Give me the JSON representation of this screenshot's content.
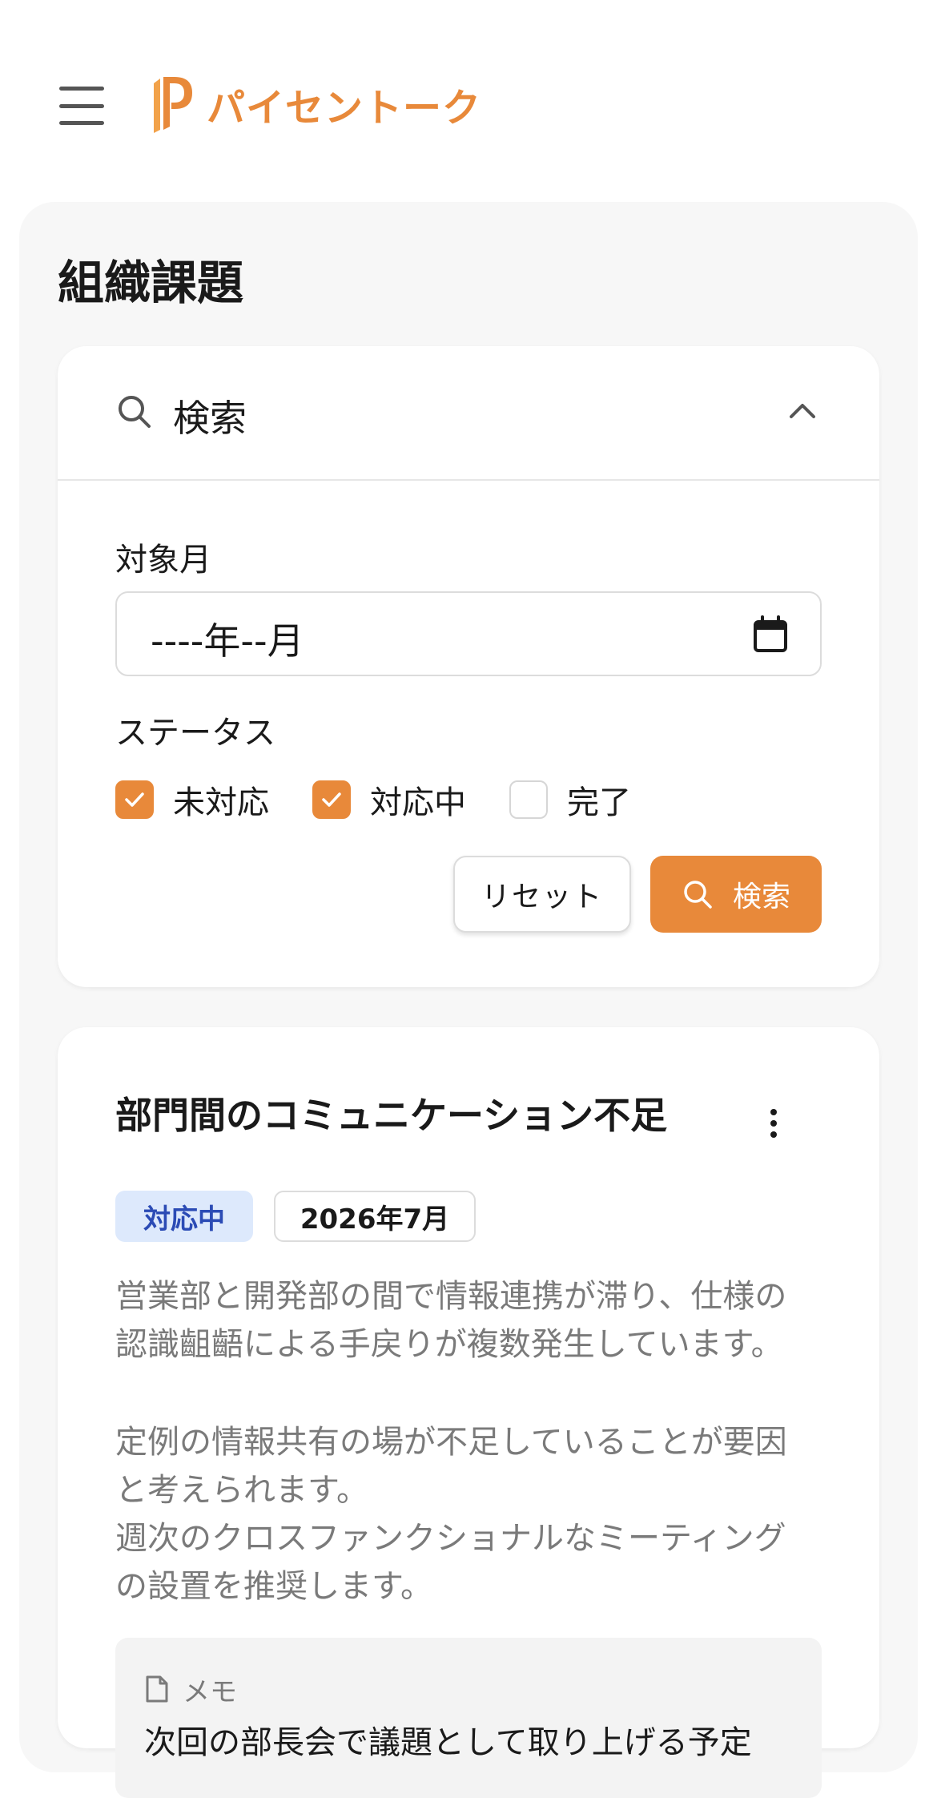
{
  "header": {
    "brand_name": "パイセントーク",
    "menu_icon": "hamburger-menu-icon",
    "brand_color": "#e8893a"
  },
  "page": {
    "title": "組織課題"
  },
  "search": {
    "title": "検索",
    "expanded": true,
    "month_label": "対象月",
    "month_value": "----年--月",
    "status_label": "ステータス",
    "statuses": [
      {
        "label": "未対応",
        "checked": true
      },
      {
        "label": "対応中",
        "checked": true
      },
      {
        "label": "完了",
        "checked": false
      }
    ],
    "reset_label": "リセット",
    "search_label": "検索"
  },
  "issues": [
    {
      "title": "部門間のコミュニケーション不足",
      "status": "対応中",
      "month": "2026年7月",
      "description": [
        "営業部と開発部の間で情報連携が滞り、仕様の",
        "認識齟齬による手戻りが複数発生しています。",
        "定例の情報共有の場が不足していることが要因",
        "と考えられます。",
        "週次のクロスファンクショナルなミーティング",
        "の設置を推奨します。"
      ],
      "memo_label": "メモ",
      "memo_text": "次回の部長会で議題として取り上げる予定"
    }
  ],
  "colors": {
    "accent": "#e8893a",
    "status_in_progress_bg": "#dde9fc",
    "status_in_progress_text": "#2b4bb5",
    "panel_bg": "#f7f7f7"
  }
}
